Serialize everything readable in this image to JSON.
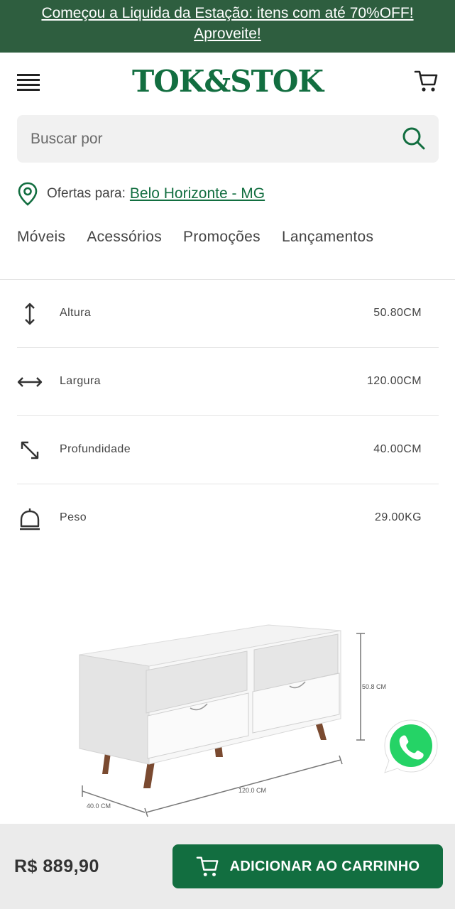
{
  "promo": {
    "text": "Começou a Liquida da Estação: itens com até 70%OFF! Aproveite!"
  },
  "header": {
    "logo": "TOK&STOK",
    "menu_icon": "hamburger-menu-icon",
    "cart_icon": "shopping-cart-icon"
  },
  "search": {
    "placeholder": "Buscar por",
    "value": ""
  },
  "location": {
    "label": "Ofertas para:",
    "city": "Belo Horizonte - MG"
  },
  "nav": {
    "items": [
      "Móveis",
      "Acessórios",
      "Promoções",
      "Lançamentos"
    ]
  },
  "specs": [
    {
      "icon": "height-arrow-icon",
      "name": "Altura",
      "value": "50.80CM"
    },
    {
      "icon": "width-arrow-icon",
      "name": "Largura",
      "value": "120.00CM"
    },
    {
      "icon": "depth-arrow-icon",
      "name": "Profundidade",
      "value": "40.00CM"
    },
    {
      "icon": "weight-icon",
      "name": "Peso",
      "value": "29.00KG"
    }
  ],
  "product_image": {
    "dims": {
      "height": "50.8 CM",
      "width": "120.0 CM",
      "depth": "40.0 CM"
    }
  },
  "bottom": {
    "price": "R$ 889,90",
    "add_to_cart": "ADICIONAR AO CARRINHO"
  },
  "colors": {
    "brand_green": "#126e40",
    "promo_bg": "#2e5e3f",
    "whatsapp_green": "#25d366"
  }
}
